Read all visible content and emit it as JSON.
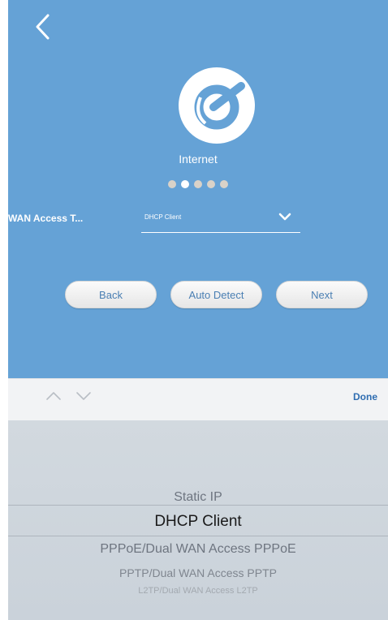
{
  "header": {
    "back_icon": "chevron-left-icon",
    "logo_icon": "internet-logo-icon",
    "logo_label": "Internet"
  },
  "progress": {
    "total_steps": 5,
    "current_step": 2
  },
  "wan_access": {
    "label": "WAN Access T...",
    "value": "DHCP Client",
    "arrow_icon": "chevron-down-icon"
  },
  "buttons": {
    "back": "Back",
    "auto_detect": "Auto Detect",
    "next": "Next"
  },
  "toolbar": {
    "prev_icon": "chevron-up-icon",
    "next_icon": "chevron-down-icon",
    "done": "Done"
  },
  "picker": {
    "options": [
      "Static IP",
      "DHCP Client",
      "PPPoE/Dual WAN Access PPPoE",
      "PPTP/Dual WAN Access PPTP",
      "L2TP/Dual WAN Access L2TP"
    ],
    "selected": "DHCP Client"
  },
  "colors": {
    "panel": "#65a2d6",
    "button_text": "#4a7fb3",
    "done": "#2f6db1"
  }
}
